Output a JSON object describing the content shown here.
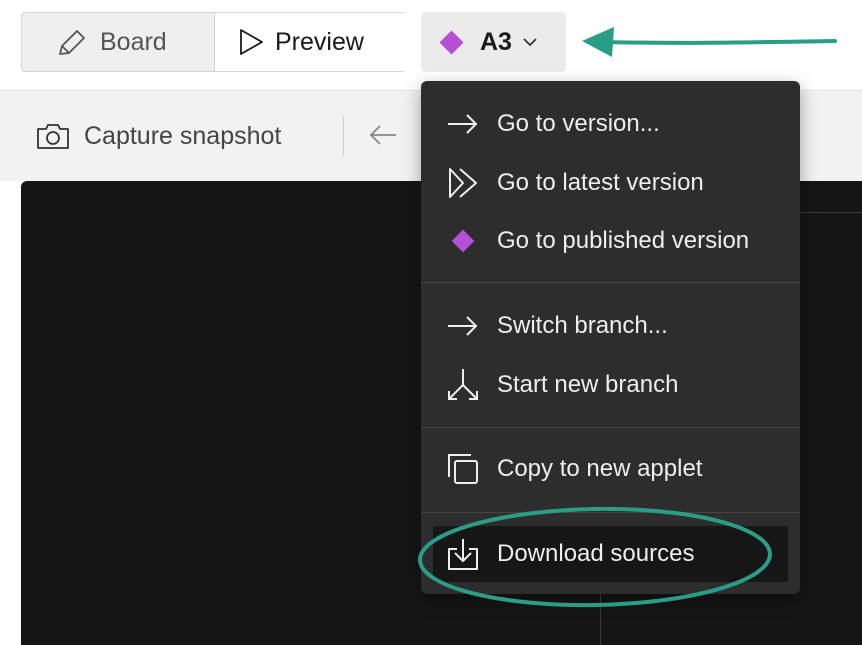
{
  "toolbar": {
    "board_label": "Board",
    "preview_label": "Preview",
    "version_label": "A3"
  },
  "subbar": {
    "capture_label": "Capture snapshot"
  },
  "menu": {
    "items": [
      {
        "label": "Go to version...",
        "icon": "arrow-right-icon"
      },
      {
        "label": "Go to latest version",
        "icon": "fast-forward-icon"
      },
      {
        "label": "Go to published version",
        "icon": "diamond-icon"
      },
      {
        "label": "Switch branch...",
        "icon": "arrow-right-icon"
      },
      {
        "label": "Start new branch",
        "icon": "branch-split-icon"
      },
      {
        "label": "Copy to new applet",
        "icon": "copy-icon"
      },
      {
        "label": "Download sources",
        "icon": "download-icon"
      }
    ]
  },
  "colors": {
    "accent_diamond": "#b44fd6",
    "annotation_teal": "#2a9d86",
    "menu_bg": "#2d2d2d",
    "canvas_bg": "#151515"
  }
}
